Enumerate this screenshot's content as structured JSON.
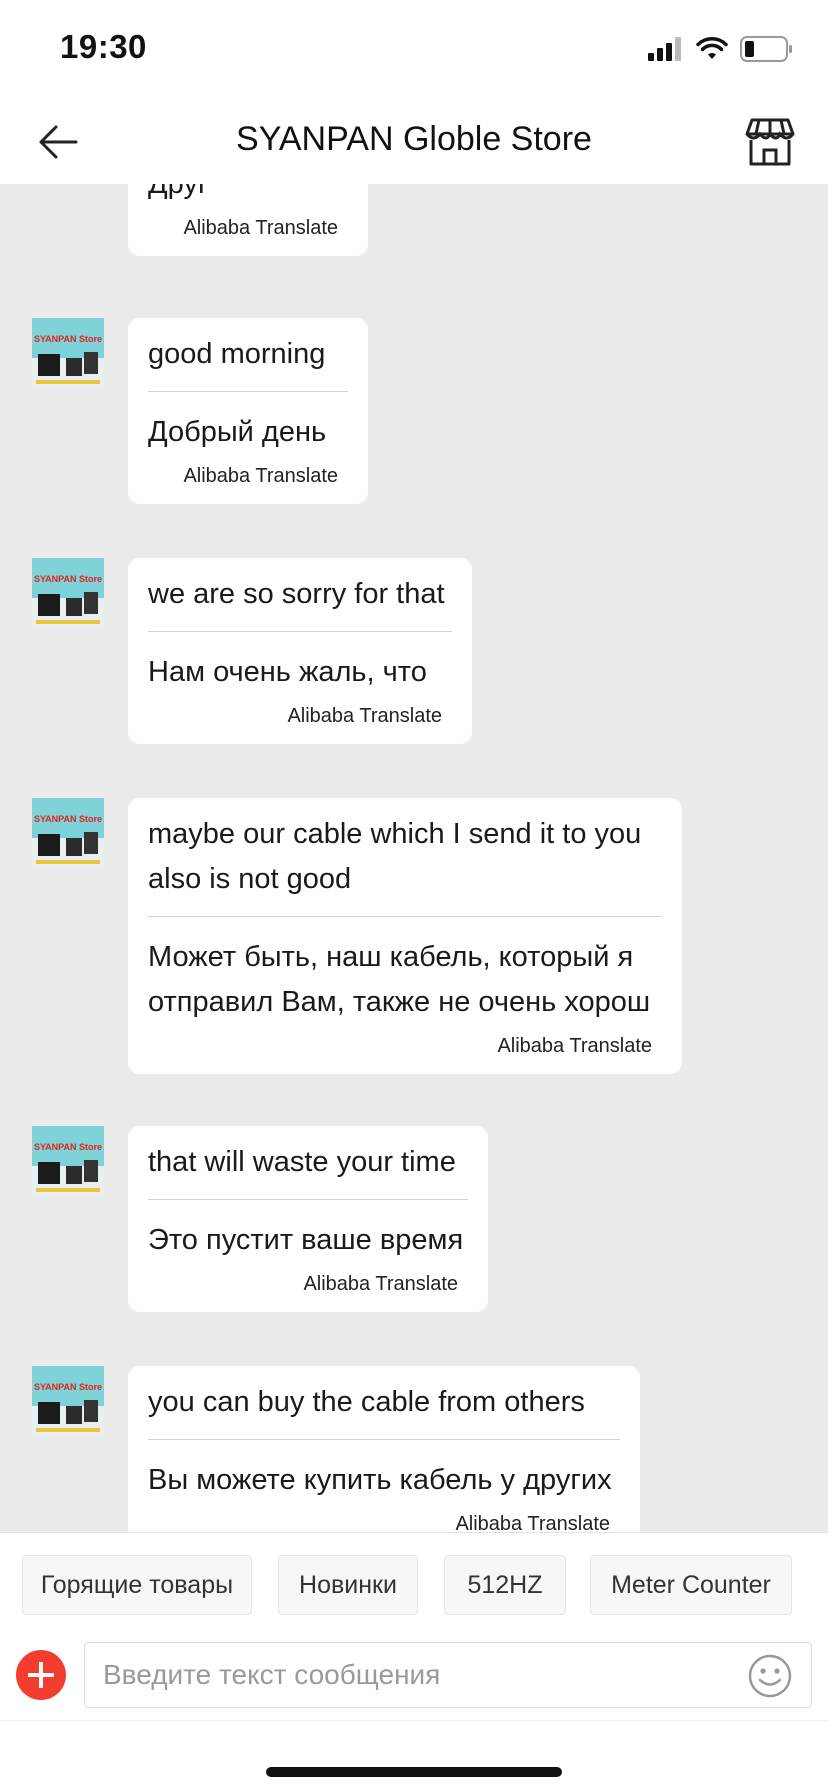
{
  "status": {
    "time": "19:30",
    "icons": [
      "signal-icon",
      "wifi-icon",
      "battery-icon"
    ]
  },
  "header": {
    "title": "SYANPAN Globle Store",
    "back_icon": "arrow-left-icon",
    "store_icon": "storefront-icon"
  },
  "chat": {
    "translate_label": "Alibaba Translate",
    "messages": [
      {
        "original": "",
        "translation": "Друг",
        "label": "Alibaba Translate"
      },
      {
        "original": "good morning",
        "translation": "Добрый день",
        "label": "Alibaba Translate"
      },
      {
        "original": "we are so sorry for that",
        "translation": "Нам очень жаль, что",
        "label": "Alibaba Translate"
      },
      {
        "original": "maybe our cable which I send it to you also is not good",
        "translation": "Может быть, наш кабель, который я отправил Вам, также не очень хорош",
        "label": "Alibaba Translate"
      },
      {
        "original": "that will waste your time",
        "translation": "Это пустит ваше время",
        "label": "Alibaba Translate"
      },
      {
        "original": "you can buy the cable from others",
        "translation": "Вы можете купить кабель у других",
        "label": "Alibaba Translate"
      }
    ],
    "avatar_text": "SYANPAN Store"
  },
  "quick_replies": [
    "Горящие товары",
    "Новинки",
    "512HZ",
    "Meter Counter"
  ],
  "composer": {
    "placeholder": "Введите текст сообщения",
    "add_icon": "plus-circle-icon",
    "emoji_icon": "smiley-icon"
  },
  "colors": {
    "background": "#ebebeb",
    "bubble": "#ffffff",
    "accent": "#f23d2f"
  }
}
